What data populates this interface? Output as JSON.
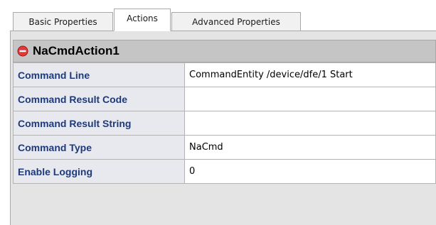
{
  "tabs": [
    {
      "label": "Basic Properties",
      "active": false
    },
    {
      "label": "Actions",
      "active": true
    },
    {
      "label": "Advanced Properties",
      "active": false
    }
  ],
  "header": {
    "title": "NaCmdAction1",
    "icon": "minus-circle-icon",
    "icon_color": "#e03a3a"
  },
  "properties": [
    {
      "key": "Command Line",
      "value": "CommandEntity /device/dfe/1 Start"
    },
    {
      "key": "Command Result Code",
      "value": ""
    },
    {
      "key": "Command Result String",
      "value": ""
    },
    {
      "key": "Command Type",
      "value": "NaCmd"
    },
    {
      "key": "Enable Logging",
      "value": "0"
    }
  ],
  "colors": {
    "key_text": "#1e3a78",
    "key_bg": "#e8e8ef",
    "header_bg": "#c5c5c5",
    "panel_bg": "#e4e4e4"
  }
}
